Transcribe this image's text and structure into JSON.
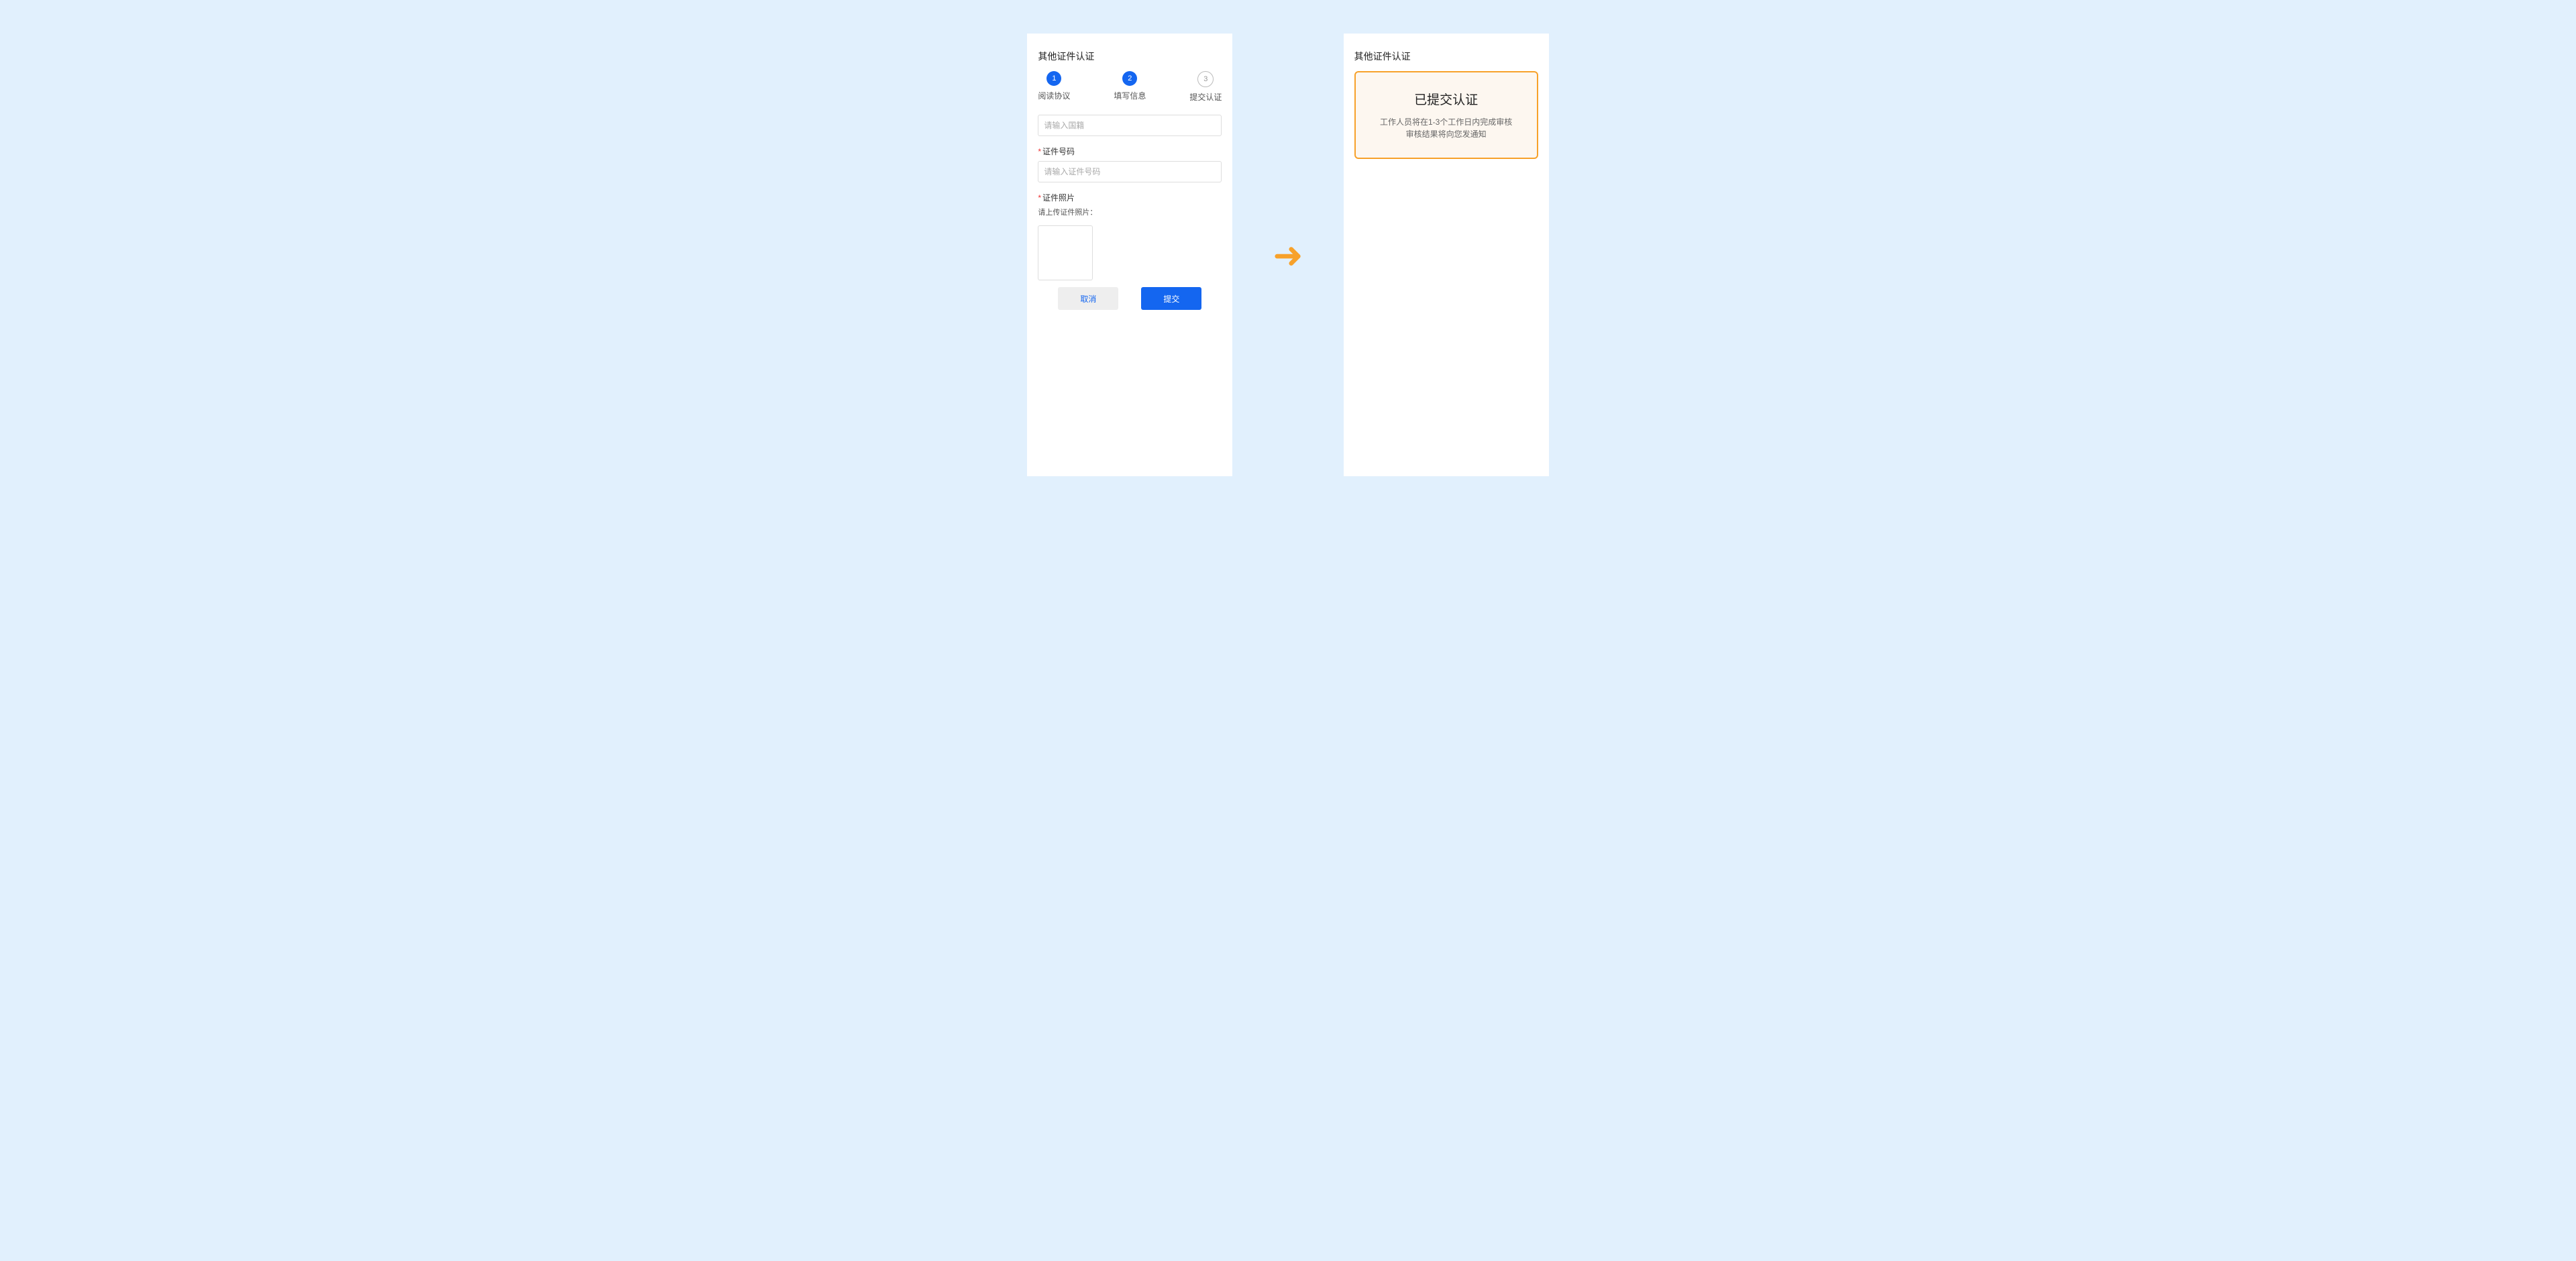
{
  "title": "其他证件认证",
  "steps": [
    "阅读协议",
    "填写信息",
    "提交认证"
  ],
  "field_nat": "请输入国籍",
  "field_no_label": "证件号码",
  "field_no": "请输入证件号码",
  "photo_label": "证件照片",
  "photo_hint": "请上传证件照片：",
  "btn_cancel": "取消",
  "btn_submit": "提交",
  "done_title": "已提交认证",
  "done_text": "工作人员将在1-3个工作日内完成审核",
  "done_text2": "审核结果将向您发通知"
}
